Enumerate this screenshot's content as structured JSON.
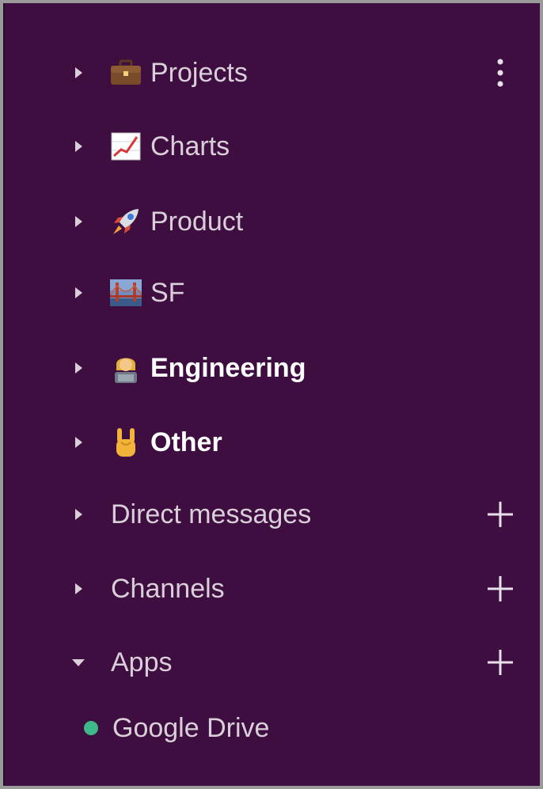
{
  "sidebar": {
    "sections": [
      {
        "label": "Projects",
        "emoji": "briefcase-icon",
        "bold": false,
        "expanded": false
      },
      {
        "label": "Charts",
        "emoji": "chart-increasing-icon",
        "bold": false,
        "expanded": false
      },
      {
        "label": "Product",
        "emoji": "rocket-icon",
        "bold": false,
        "expanded": false
      },
      {
        "label": "SF",
        "emoji": "bridge-icon",
        "bold": false,
        "expanded": false
      },
      {
        "label": "Engineering",
        "emoji": "technologist-icon",
        "bold": true,
        "expanded": false
      },
      {
        "label": "Other",
        "emoji": "sign-of-horns-icon",
        "bold": true,
        "expanded": false
      },
      {
        "label": "Direct messages",
        "emoji": null,
        "bold": false,
        "expanded": false
      },
      {
        "label": "Channels",
        "emoji": null,
        "bold": false,
        "expanded": false
      },
      {
        "label": "Apps",
        "emoji": null,
        "bold": false,
        "expanded": true
      }
    ],
    "apps": [
      {
        "label": "Google Drive",
        "status_color": "#3fb88a"
      }
    ]
  },
  "colors": {
    "background": "#3f0e40",
    "text": "#d9cfd9",
    "bold_text": "#ffffff"
  }
}
